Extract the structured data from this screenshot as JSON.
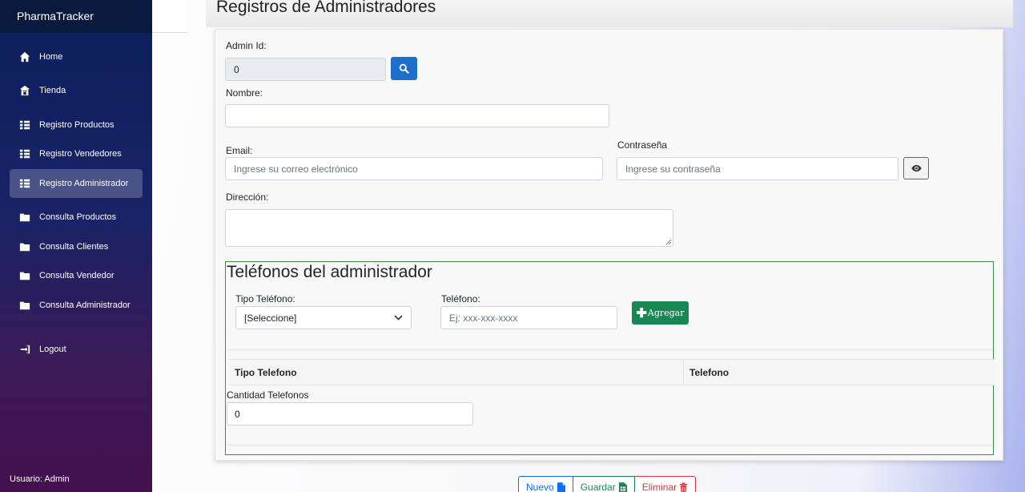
{
  "sidebar": {
    "brand": "PharmaTracker",
    "items": [
      {
        "label": "Home",
        "icon": "home-icon"
      },
      {
        "label": "Tienda",
        "icon": "store-icon"
      },
      {
        "label": "Registro Productos",
        "icon": "list-icon"
      },
      {
        "label": "Registro Vendedores",
        "icon": "list-icon"
      },
      {
        "label": "Registro Administrador",
        "icon": "list-icon",
        "active": true
      },
      {
        "label": "Consulta Productos",
        "icon": "folder-icon"
      },
      {
        "label": "Consulta Clientes",
        "icon": "folder-icon"
      },
      {
        "label": "Consulta Vendedor",
        "icon": "folder-icon"
      },
      {
        "label": "Consulta Administrador",
        "icon": "folder-icon"
      },
      {
        "label": "Logout",
        "icon": "logout-icon"
      }
    ],
    "user": "Usuario: Admin"
  },
  "page": {
    "title": "Registros de Administradores"
  },
  "form": {
    "admin_id_label": "Admin Id:",
    "admin_id_value": "0",
    "nombre_label": "Nombre:",
    "nombre_value": "",
    "email_label": "Email:",
    "email_placeholder": "Ingrese su correo electrónico",
    "password_label": "Contraseña",
    "password_placeholder": "Ingrese su contraseña",
    "direccion_label": "Dirección:",
    "direccion_value": ""
  },
  "phones": {
    "title": "Teléfonos del administrador",
    "tipo_label": "Tipo Teléfono:",
    "tipo_selected": "[Seleccione]",
    "telefono_label": "Teléfono:",
    "telefono_placeholder": "Ej: xxx-xxx-xxxx",
    "add_button": "Agregar",
    "table_headers": [
      "Tipo Telefono",
      "Telefono"
    ],
    "cantidad_label": "Cantidad Telefonos",
    "cantidad_value": "0"
  },
  "actions": {
    "new": "Nuevo",
    "save": "Guardar",
    "delete": "Eliminar"
  },
  "colors": {
    "primary": "#1e6fc9",
    "success": "#198754",
    "danger": "#dc3545",
    "sidebar_top": "#0b1f5c",
    "sidebar_bottom": "#44104e"
  }
}
